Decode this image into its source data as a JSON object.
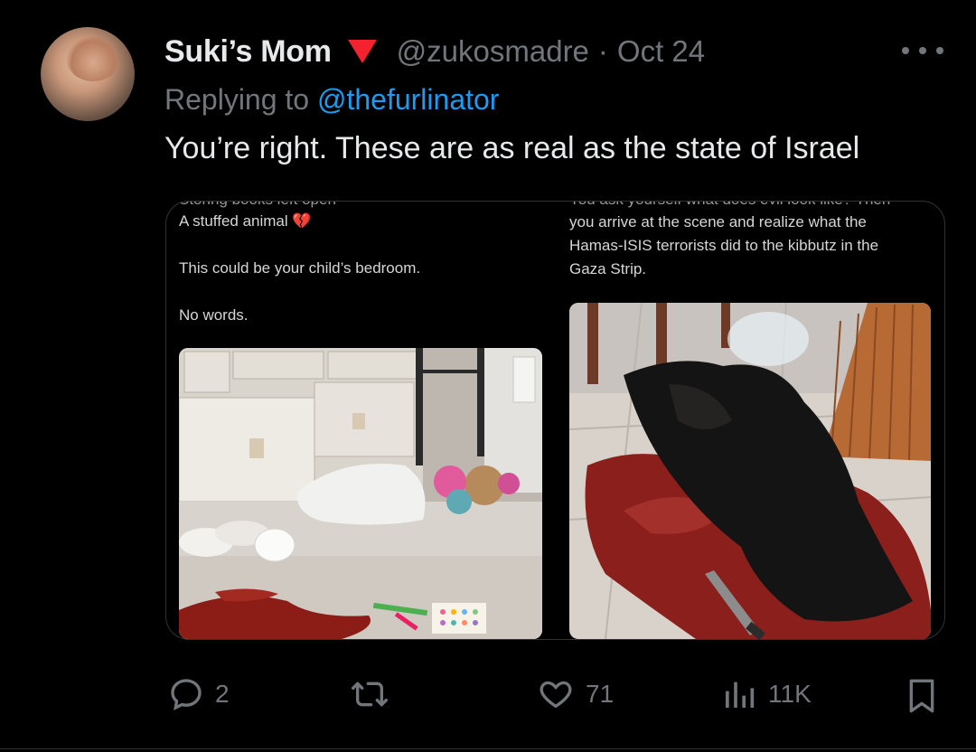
{
  "tweet": {
    "display_name": "Suki’s Mom",
    "handle": "@zukosmadre",
    "separator": "·",
    "date": "Oct 24",
    "replying_prefix": "Replying to ",
    "replying_to": "@thefurlinator",
    "text": "You’re right. These are as real as the state of Israel",
    "more_icon": "more-horizontal-icon",
    "badge_icon": "red-triangle-icon",
    "badge_color": "#f4212e",
    "link_color": "#1d9bf0"
  },
  "media": {
    "left": {
      "cut_line": "Storing books left open",
      "line1": "A stuffed animal",
      "line1_emoji": "💔",
      "line2": "This could be your child’s bedroom.",
      "line3": "No words."
    },
    "right": {
      "cut_line": "You ask yourself what does evil look like? Then",
      "lines": [
        "you arrive at the scene and realize what the",
        "Hamas-ISIS terrorists did to the kibbutz in the",
        "Gaza Strip."
      ]
    }
  },
  "actions": {
    "reply_count": "2",
    "retweet_count": "",
    "like_count": "71",
    "views_count": "11K",
    "reply_icon": "reply-icon",
    "retweet_icon": "retweet-icon",
    "like_icon": "heart-icon",
    "views_icon": "views-icon",
    "bookmark_icon": "bookmark-icon"
  }
}
